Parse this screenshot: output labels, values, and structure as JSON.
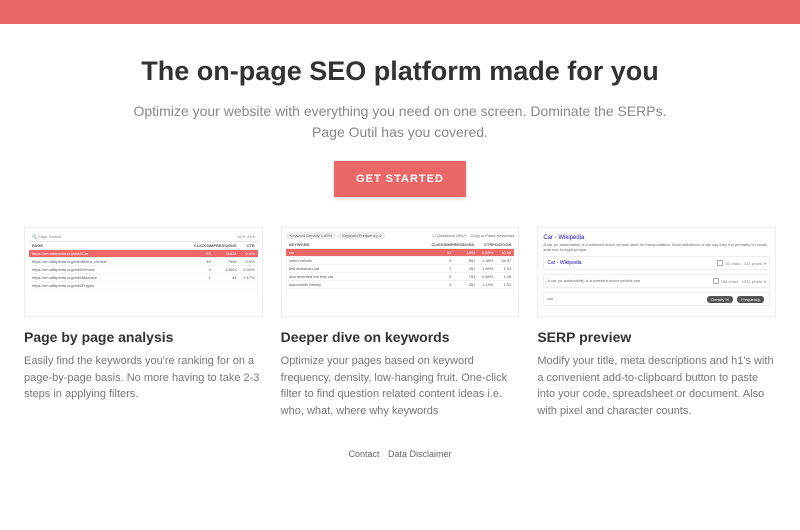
{
  "hero": {
    "title": "The on-page SEO platform made for you",
    "subtitle": "Optimize your website with everything you need on one screen. Dominate the SERPs. Page Outil has you covered.",
    "cta": "GET STARTED"
  },
  "features": [
    {
      "title": "Page by page analysis",
      "desc": "Easily find the keywords you're ranking for on a page-by-page basis. No more having to take 2-3 steps in applying filters."
    },
    {
      "title": "Deeper dive on keywords",
      "desc": "Optimize your pages based on keyword frequency, density, low-hanging fruit. One-click filter to find question related content ideas i.e. who, what, where why keywords"
    },
    {
      "title": "SERP preview",
      "desc": "Modify your title, meta descriptions and h1's with a convenient add-to-clipboard button to paste into your code, spreadsheet or document. Also with pixel and character counts."
    }
  ],
  "footer": {
    "contact": "Contact",
    "disclaimer": "Data Disclaimer"
  },
  "shot1": {
    "search": "Page Search",
    "all": "All",
    "cols": [
      "PAGE",
      "CLICKS",
      "IMPRESSIONS",
      "CTR"
    ],
    "rows": [
      {
        "page": "https://en.wikipedia.org/wiki/Car",
        "c": "53",
        "i": "11631",
        "ctr": "0.4%",
        "hl": true
      },
      {
        "page": "https://en.wikipedia.org/wiki/Motor_vehicle",
        "c": "48",
        "i": "7585",
        "ctr": "0.5%"
      },
      {
        "page": "https://en.wikipedia.org/wiki/Vehicle",
        "c": "3",
        "i": "13004",
        "ctr": "0.02%"
      },
      {
        "page": "https://en.wikipedia.org/wiki/Machine",
        "c": "1",
        "i": "46",
        "ctr": "2.17%"
      },
      {
        "page": "https://en.wikipedia.org/wiki/Engine",
        "c": "",
        "i": "",
        "ctr": ""
      }
    ]
  },
  "shot2": {
    "chips": [
      "Keyword Density 1.65%",
      "Keyword Frequency 4"
    ],
    "qonly": "Questions ONLY",
    "copy": "Copy to Paste Keywords",
    "cols": [
      "KEYWORD",
      "CLICKS",
      "IMPRESSIONS",
      "CTR",
      "POSITION"
    ],
    "rows": [
      {
        "k": "car",
        "c": "13",
        "i": "1895",
        "ctr": "0.53%",
        "p": "10.06",
        "hl": true
      },
      {
        "k": "motor vehicle",
        "c": "9",
        "i": "651",
        "ctr": "1.38%",
        "p": "26.97"
      },
      {
        "k": "first american car",
        "c": "7",
        "i": "451",
        "ctr": "1.55%",
        "p": "1.03"
      },
      {
        "k": "who invented the first car",
        "c": "5",
        "i": "753",
        "ctr": "0.66%",
        "p": "1.08"
      },
      {
        "k": "automobile history",
        "c": "4",
        "i": "351",
        "ctr": "1.14%",
        "p": "1.01"
      }
    ]
  },
  "shot3": {
    "title1": "Car - Wikipedia",
    "desc1": "A car (or automobile) is a wheeled motor vehicle used for transportation. Most definitions of car say they run primarily on roads, seat one to eight people...",
    "title2": "Car - Wikipedia",
    "badge2": "15 chars · 123 pixels",
    "desc2": "A car (or automobile) is a wheeled motor vehicle use",
    "badge3": "158 chars · 1232 pixels",
    "h1": "car",
    "tags": [
      "Density %",
      "Frequency"
    ]
  }
}
